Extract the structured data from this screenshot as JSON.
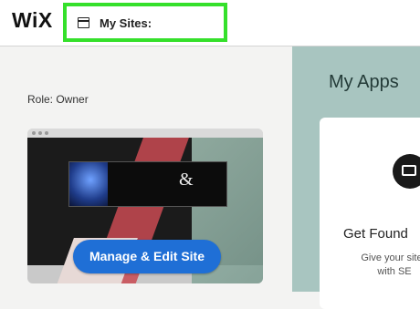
{
  "header": {
    "logo": "WiX",
    "sites_button_label": "My Sites:"
  },
  "left": {
    "role_text": "Role: Owner",
    "preview": {
      "banner_glyph": "&"
    },
    "manage_button_label": "Manage & Edit Site"
  },
  "right": {
    "title": "My Apps",
    "card": {
      "title": "Get Found",
      "text_line1": "Give your site t",
      "text_line2": "with SE"
    }
  },
  "colors": {
    "highlight_border": "#35e02b",
    "primary_button": "#1f6fd6",
    "right_panel_bg": "#a8c5c0"
  }
}
